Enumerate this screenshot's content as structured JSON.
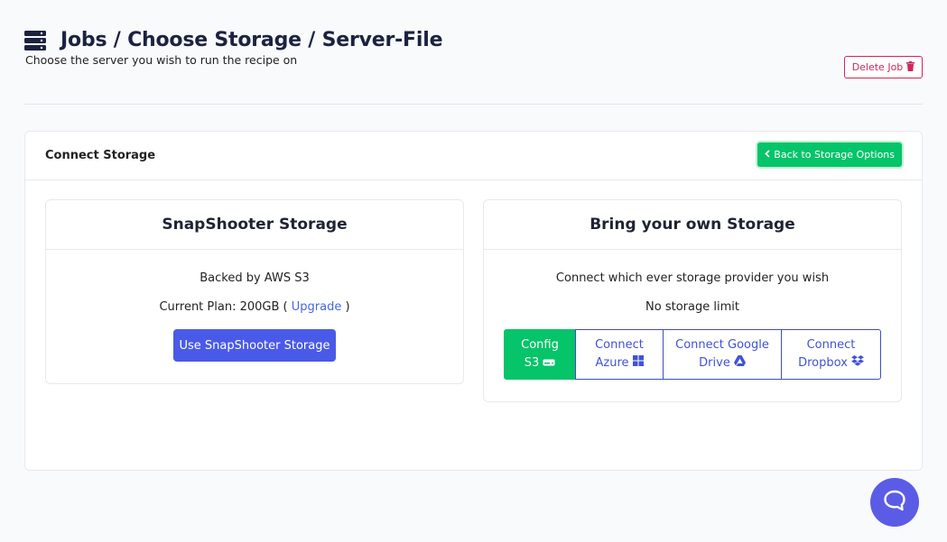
{
  "header": {
    "title": "Jobs / Choose Storage / Server-File",
    "subtitle": "Choose the server you wish to run the recipe on",
    "delete_label": "Delete Job"
  },
  "card": {
    "title": "Connect Storage",
    "back_label": "Back to Storage Options"
  },
  "snapshooter": {
    "title": "SnapShooter Storage",
    "backed_by": "Backed by AWS S3",
    "plan_prefix": "Current Plan: 200GB (",
    "upgrade_label": "Upgrade",
    "plan_suffix": ")",
    "use_label": "Use SnapShooter Storage"
  },
  "byos": {
    "title": "Bring your own Storage",
    "line1": "Connect which ever storage provider you wish",
    "line2": "No storage limit",
    "options": [
      {
        "line1": "Config",
        "line2": "S3",
        "icon": "hdd-icon"
      },
      {
        "line1": "Connect",
        "line2": "Azure",
        "icon": "windows-icon"
      },
      {
        "line1": "Connect Google",
        "line2": "Drive",
        "icon": "google-drive-icon"
      },
      {
        "line1": "Connect",
        "line2": "Dropbox",
        "icon": "dropbox-icon"
      }
    ]
  },
  "colors": {
    "primary": "#4a5ae8",
    "success": "#05c469",
    "danger": "#d5245b",
    "chat": "#5b5ce6"
  }
}
